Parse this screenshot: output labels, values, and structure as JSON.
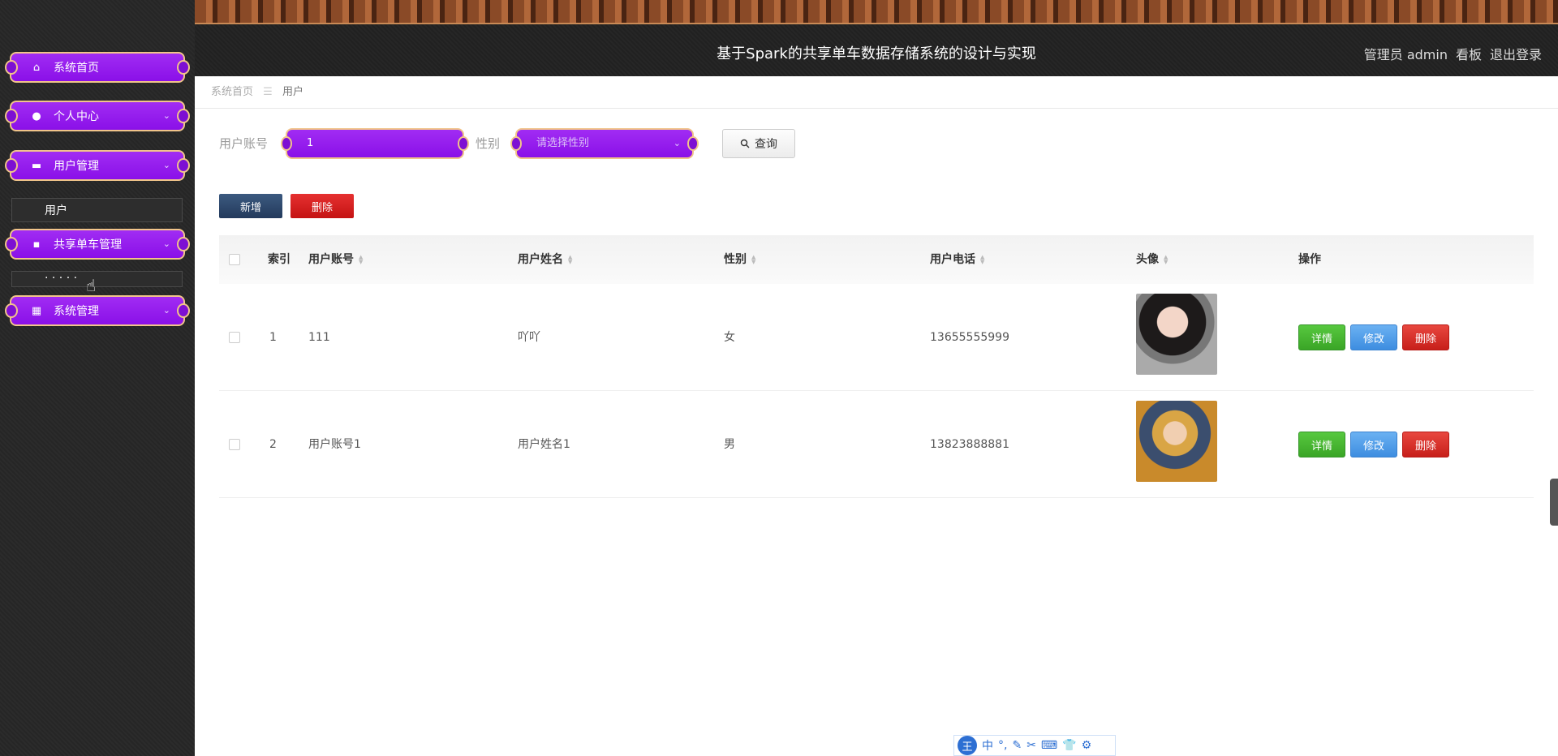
{
  "sidebar": {
    "items": [
      {
        "label": "系统首页",
        "icon": "home-icon",
        "glyph": "⌂"
      },
      {
        "label": "个人中心",
        "icon": "person-icon",
        "glyph": "●"
      },
      {
        "label": "用户管理",
        "icon": "user-manage-icon",
        "glyph": "▬"
      },
      {
        "label": "共享单车管理",
        "icon": "chat-icon",
        "glyph": "▪"
      },
      {
        "label": "系统管理",
        "icon": "grid-icon",
        "glyph": "▦"
      }
    ],
    "sub_items": [
      {
        "label": "用户"
      },
      {
        "label": "· · · · ·"
      }
    ],
    "arrow_glyph": "⌄",
    "colors": {
      "item_bg": "#9b21f0",
      "item_border": "#f1c48a"
    }
  },
  "header": {
    "title": "基于Spark的共享单车数据存储系统的设计与实现",
    "role": "管理员",
    "username": "admin",
    "board_link": "看板",
    "logout_link": "退出登录"
  },
  "breadcrumb": {
    "home": "系统首页",
    "separator": "☰",
    "current": "用户"
  },
  "search": {
    "account_label": "用户账号",
    "account_value": "1",
    "gender_label": "性别",
    "gender_placeholder": "请选择性别",
    "search_button": "查询",
    "search_icon": "search-icon"
  },
  "actions": {
    "add_label": "新增",
    "delete_label": "删除"
  },
  "table": {
    "headers": [
      "索引",
      "用户账号",
      "用户姓名",
      "性别",
      "用户电话",
      "头像",
      "操作"
    ],
    "rows": [
      {
        "index": "1",
        "account": "111",
        "name": "吖吖",
        "gender": "女",
        "phone": "13655555999"
      },
      {
        "index": "2",
        "account": "用户账号1",
        "name": "用户姓名1",
        "gender": "男",
        "phone": "13823888881"
      }
    ],
    "op_labels": {
      "detail": "详情",
      "edit": "修改",
      "delete": "删除"
    }
  },
  "ime": {
    "logo": "王",
    "items": [
      "中",
      "°,",
      "✎",
      "✂",
      "⌨",
      "👕",
      "⚙"
    ]
  }
}
